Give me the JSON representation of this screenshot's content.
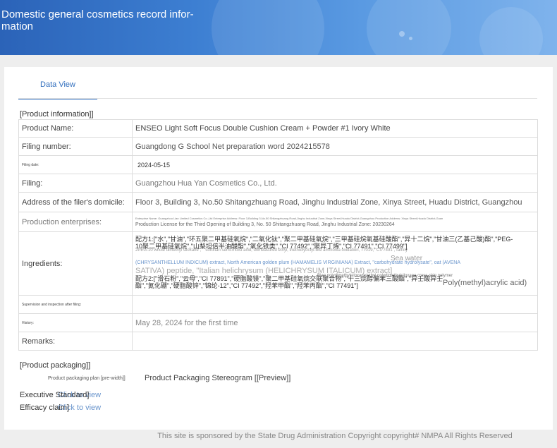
{
  "header": {
    "title": "Domestic general cosmetics record infor-mation"
  },
  "tabs": [
    {
      "label": "Data View"
    }
  ],
  "sections": {
    "product_information": "[Product information]]",
    "product_packaging": "[Product packaging]]"
  },
  "table": {
    "product_name": {
      "label": "Product Name:",
      "value": "ENSEO Light Soft Focus Double Cushion Cream + Powder #1 Ivory White"
    },
    "filing_number": {
      "label": "Filing number:",
      "value": "Guangdong G School Net preparation word 2024215578"
    },
    "filing_date": {
      "label": "Filing date:",
      "value": "2024-05-15"
    },
    "filing": {
      "label": "Filing:",
      "value": "Guangzhou Hua Yan Cosmetics Co., Ltd."
    },
    "address": {
      "label": "Address of the filer's domicile:",
      "value": "Floor 3, Building 3, No.50 Shitangzhuang Road, Jinghu Industrial Zone, Xinya Street, Huadu District, Guangzhou"
    },
    "production": {
      "label": "Production enterprises:",
      "line1": "Enterprise Name: Guangzhou Lian Limited Cosmetics Co.,Ltd Enterprise Address: Floor 3,Building 3,No.50 Shitangzhuang Road,Jinghu Industrial Zone,Xinya Street,Huadu District,Guangzhou Production Address: Xinya Street,Huadu District,Guan",
      "line2": "Production License for the Third Opening of Building 3, No. 50 Shitangzhuang Road, Jinghu Industrial Zone: 20230264"
    },
    "ingredients": {
      "label": "Ingredients:",
      "zh1": "配方1:[\"水\",\"甘油\",\"环五聚二甲基硅氧烷\",\"二氧化钛\",\"聚二甲基硅氧烷\",\"三甲基硅烷氧基硅酸酯\",\"异十二烷\",\"甘油三(乙基己酸)酯\",\"PEG-10聚二甲基硅氧烷\",\"山梨坦倍半油酸酯\",\"氧化铁类\",\"CI 77492\",\"聚异丁烯\",\"CI 77491\",\"CI 77499\"]",
      "en1": "2PEG-10 whole dimethyl siloxane\",\"\" sorbitan semi-moist acid, unmeasured ethyl, triethoxyoctyl-like ammonia oxidation, 77019, \"CI77491\", family",
      "sea": "Sea water",
      "blue": "(CHRYSANTHELLUM INDICUM) extract, North American golden plum (HAMAMELIS VIRGINIANA) Extract, \"carbohydrate hydrolysate\", oat (AVENA",
      "ital": "SATIVA) peptide, \"Italian helichrysum (HELICHRYSUM ITALICUM) extract]",
      "zh2": "配方2:[\"滑石粉\",\"云母\",\"CI 77891\",\"硬脂酸镁\",\"聚二甲基硅氧烷交联聚合物\",\"十三烷醇偏苯三酸酯\",\"异壬酸异壬酯\",\"氮化硼\",\"硬脂酸锌\",\"锦纶-12\",\"CI 77492\",\"羟苯甲酯\",\"羟苯丙酯\",\"CI 77491\"]",
      "bian": "Bian polydimethylsiloxane/ethyl polydimethylsiloxane cross-skin polymer",
      "poly": "Poly(methyl)acrylic acid)"
    },
    "supervision": {
      "label": "Supervision and inspection after filing:",
      "value": ""
    },
    "history": {
      "label": "History:",
      "value": "May 28, 2024 for the first time"
    },
    "remarks": {
      "label": "Remarks:",
      "value": ""
    }
  },
  "packaging": {
    "plan_label": "Product packaging plan [pre-width]]",
    "plan_value": "Product Packaging Stereogram [[Preview]]"
  },
  "executive_standard": {
    "label": "Executive Standard]",
    "link": "Click to view"
  },
  "efficacy_claim": {
    "label": "Efficacy claim]",
    "link": "Click to view"
  },
  "footer": "This site is sponsored by the State Drug Administration Copyright copyright# NMPA All Rights Reserved"
}
